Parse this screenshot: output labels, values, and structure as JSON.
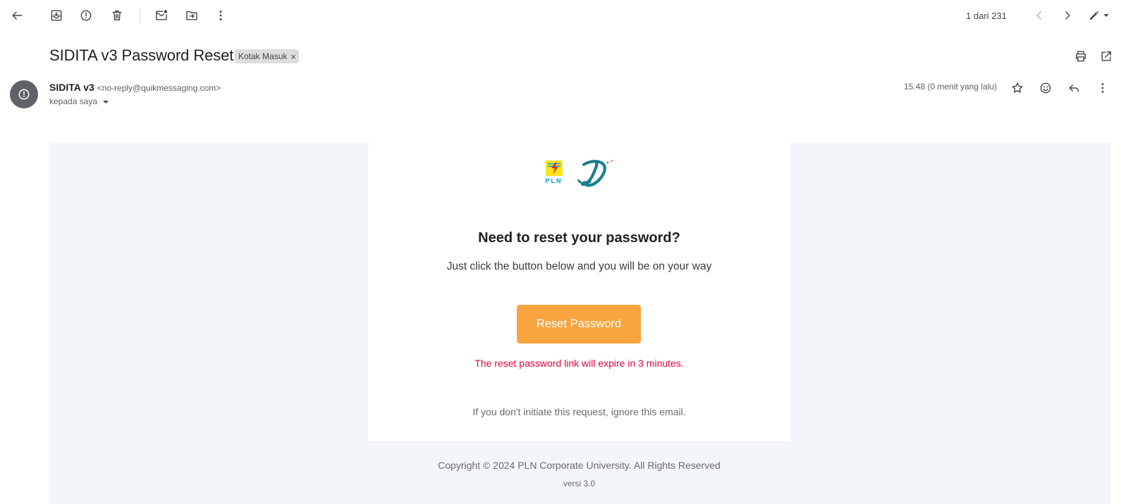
{
  "toolbar": {
    "back_icon": "arrow-left-icon",
    "archive_icon": "archive-icon",
    "spam_icon": "report-spam-icon",
    "delete_icon": "trash-icon",
    "mark_unread_icon": "mark-unread-icon",
    "move_icon": "move-to-folder-icon",
    "more_icon": "more-vert-icon",
    "counter": "1 dari 231",
    "prev_icon": "chevron-left-icon",
    "next_icon": "chevron-right-icon",
    "pen_icon": "pen-icon"
  },
  "header": {
    "subject": "SIDITA v3 Password Reset",
    "label_chip": "Kotak Masuk",
    "label_remove": "×",
    "print_icon": "print-icon",
    "open_new_window_icon": "open-in-new-icon"
  },
  "message": {
    "sender_name": "SIDITA v3",
    "sender_email": "<no-reply@quikmessaging.com>",
    "to_label": "kepada saya",
    "time": "15.48 (0 menit yang lalu)",
    "avatar_icon": "alert-circle-icon",
    "star_icon": "star-icon",
    "emoji_icon": "emoji-icon",
    "reply_icon": "reply-icon",
    "more_icon": "more-vert-icon"
  },
  "email_body": {
    "logo_pln_text": "PLN",
    "heading": "Need to reset your password?",
    "lead": "Just click the button below and you will be on your way",
    "button_label": "Reset Password",
    "expiry_notice": "The reset password link will expire in 3 minutes.",
    "ignore_notice": "If you don't initiate this request, ignore this email.",
    "copyright": "Copyright © 2024 PLN Corporate University. All Rights Reserved",
    "version": "versi 3.0",
    "colors": {
      "button": "#f9a43e",
      "warning": "#e8003c",
      "background": "#f2f5fa"
    }
  }
}
